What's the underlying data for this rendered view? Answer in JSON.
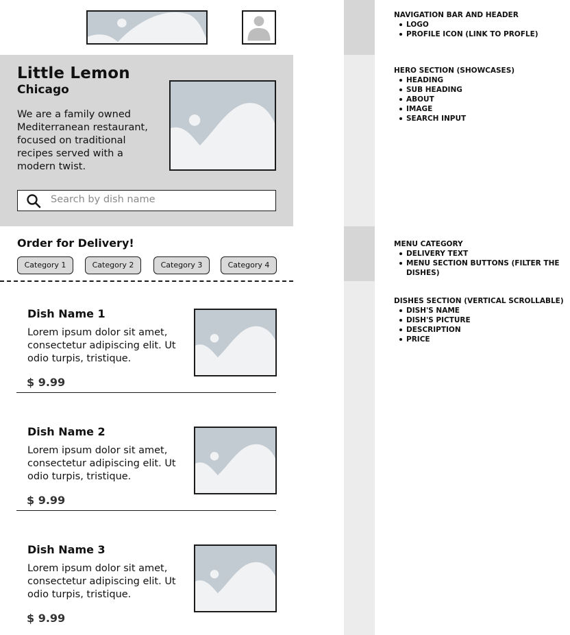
{
  "header": {
    "logo_alt": "logo-placeholder-icon",
    "profile_icon": "person-silhouette-icon"
  },
  "hero": {
    "title": "Little Lemon",
    "subtitle": "Chicago",
    "about": "We are a family owned Mediterranean restaurant, focused on traditional recipes served with a modern twist.",
    "image_icon": "image-placeholder-icon",
    "search": {
      "placeholder": "Search by dish name",
      "icon": "search-icon"
    }
  },
  "menu_category": {
    "delivery_text": "Order for Delivery!",
    "categories": [
      "Category 1",
      "Category 2",
      "Category 3",
      "Category 4"
    ]
  },
  "dishes": [
    {
      "name": "Dish Name 1",
      "description": "Lorem ipsum dolor sit amet, consectetur adipiscing elit. Ut odio turpis, tristique.",
      "price": "$ 9.99"
    },
    {
      "name": "Dish Name 2",
      "description": "Lorem ipsum dolor sit amet, consectetur adipiscing elit. Ut odio turpis, tristique.",
      "price": "$ 9.99"
    },
    {
      "name": "Dish Name 3",
      "description": "Lorem ipsum dolor sit amet, consectetur adipiscing elit. Ut odio turpis, tristique.",
      "price": "$ 9.99"
    }
  ],
  "annotations": [
    {
      "title": "NAVIGATION BAR AND HEADER",
      "items": [
        "LOGO",
        "PROFILE ICON (LINK TO PROFLE)"
      ]
    },
    {
      "title": "HERO SECTION (SHOWCASES)",
      "items": [
        "HEADING",
        "SUB HEADING",
        "ABOUT",
        "IMAGE",
        "SEARCH INPUT"
      ]
    },
    {
      "title": "MENU CATEGORY",
      "items": [
        "DELIVERY TEXT",
        "MENU SECTION BUTTONS (FILTER THE DISHES)"
      ]
    },
    {
      "title": "DISHES SECTION (VERTICAL SCROLLABLE)",
      "items": [
        "DISH'S NAME",
        "DISH'S PICTURE",
        "DESCRIPTION",
        "PRICE"
      ]
    }
  ],
  "colors": {
    "hero_bg": "#d6d6d6",
    "placeholder_bg": "#c3cbd2",
    "placeholder_fg": "#f1f2f4",
    "category_button_bg": "#d9d9d9",
    "strip_light": "#ececec",
    "strip_dark": "#d6d6d6"
  }
}
